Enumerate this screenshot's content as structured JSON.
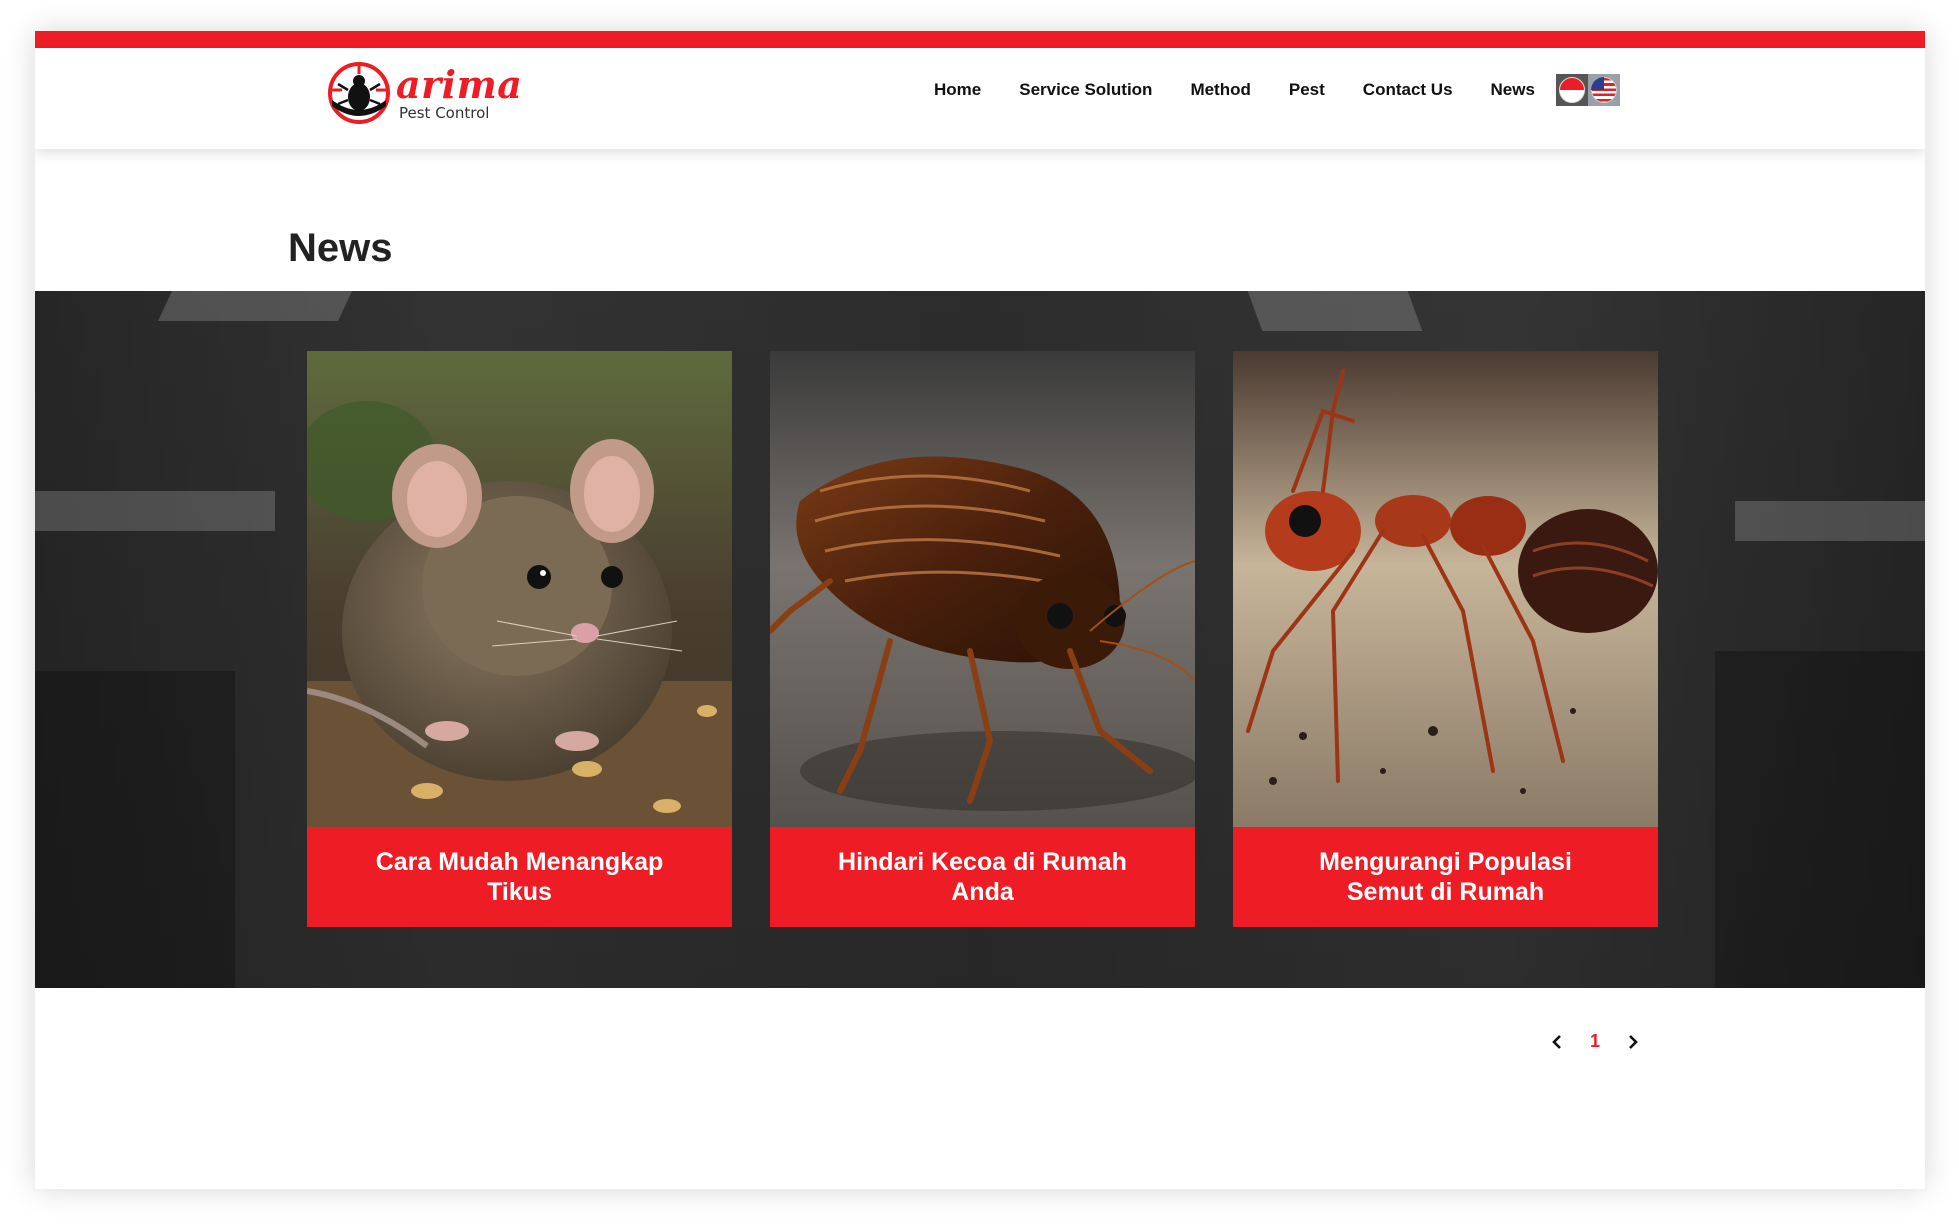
{
  "brand": {
    "name": "arima",
    "tagline": "Pest Control",
    "accent_color": "#ee1c24",
    "logo_icon": "beetle-crosshair-icon"
  },
  "nav": {
    "items": [
      {
        "label": "Home"
      },
      {
        "label": "Service Solution"
      },
      {
        "label": "Method"
      },
      {
        "label": "Pest"
      },
      {
        "label": "Contact Us"
      },
      {
        "label": "News"
      }
    ],
    "languages": [
      {
        "icon": "indonesia-flag-icon"
      },
      {
        "icon": "usa-flag-icon"
      }
    ]
  },
  "page": {
    "title": "News"
  },
  "news": {
    "cards": [
      {
        "title": "Cara Mudah Menangkap Tikus",
        "image_icon": "rat-photo"
      },
      {
        "title": "Hindari Kecoa di Rumah Anda",
        "image_icon": "cockroach-photo"
      },
      {
        "title": "Mengurangi Populasi Semut di Rumah",
        "image_icon": "ant-photo"
      }
    ]
  },
  "pagination": {
    "current_page": "1",
    "prev_icon": "chevron-left-icon",
    "next_icon": "chevron-right-icon"
  }
}
